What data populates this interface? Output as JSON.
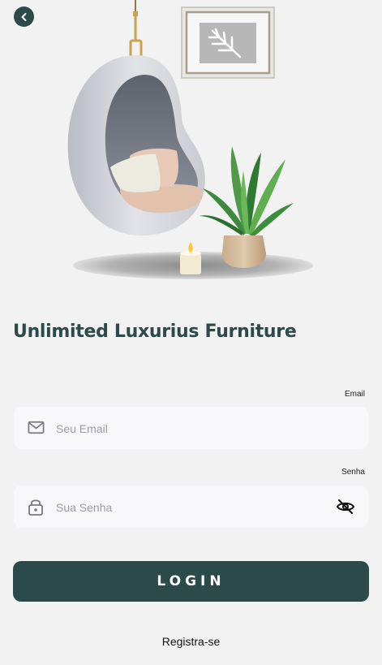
{
  "header": {
    "back_icon": "chevron-left-icon"
  },
  "hero": {
    "illustration": "hanging-egg-chair-with-plant-candle-and-frame"
  },
  "title": "Unlimited Luxurius Furniture",
  "email": {
    "label": "Email",
    "placeholder": "Seu Email",
    "value": "",
    "icon": "mail-icon"
  },
  "password": {
    "label": "Senha",
    "placeholder": "Sua Senha",
    "value": "",
    "icon": "lock-icon",
    "toggle_icon": "eye-off-icon"
  },
  "login_button": "LOGIN",
  "register_link": "Registra-se",
  "colors": {
    "primary": "#2c4a4a",
    "background": "#f2f2f2",
    "field_bg": "#f8f8fb",
    "placeholder": "#9a9ca6"
  }
}
